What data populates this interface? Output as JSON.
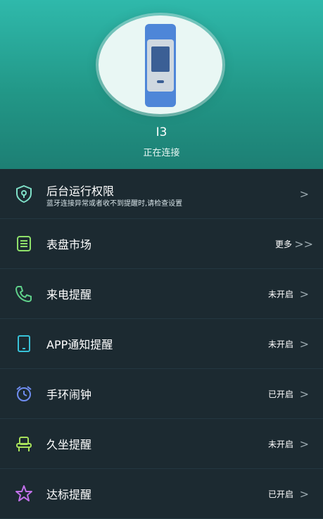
{
  "device": {
    "name": "I3",
    "status": "正在连接"
  },
  "colors": {
    "header_top": "#2fb9ab",
    "header_bottom": "#1d7f74",
    "list_bg": "#1c2a31",
    "band": "#4e86d8"
  },
  "items": [
    {
      "icon": "shield-icon",
      "title": "后台运行权限",
      "subtitle": "蓝牙连接异常或者收不到提醒时,请检查设置",
      "right": "",
      "chevron": ">"
    },
    {
      "icon": "watchface-icon",
      "title": "表盘市场",
      "subtitle": "",
      "right": "更多",
      "chevron": ">>"
    },
    {
      "icon": "phone-icon",
      "title": "来电提醒",
      "subtitle": "",
      "right": "未开启",
      "chevron": ">"
    },
    {
      "icon": "tablet-icon",
      "title": "APP通知提醒",
      "subtitle": "",
      "right": "未开启",
      "chevron": ">"
    },
    {
      "icon": "alarm-clock-icon",
      "title": "手环闹钟",
      "subtitle": "",
      "right": "已开启",
      "chevron": ">"
    },
    {
      "icon": "chair-icon",
      "title": "久坐提醒",
      "subtitle": "",
      "right": "未开启",
      "chevron": ">"
    },
    {
      "icon": "star-icon",
      "title": "达标提醒",
      "subtitle": "",
      "right": "已开启",
      "chevron": ">"
    }
  ]
}
